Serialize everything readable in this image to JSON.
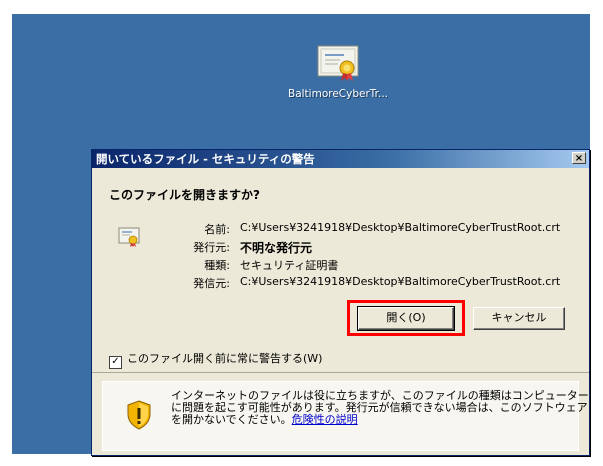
{
  "desktop": {
    "icon_label": "BaltimoreCyberTr..."
  },
  "dialog": {
    "title": "開いているファイル - セキュリティの警告",
    "close_label": "×",
    "question": "このファイルを開きますか?",
    "fields": [
      {
        "label": "名前:",
        "value": "C:¥Users¥3241918¥Desktop¥BaltimoreCyberTrustRoot.crt"
      },
      {
        "label": "発行元:",
        "value": "不明な発行元"
      },
      {
        "label": "種類:",
        "value": "セキュリティ証明書"
      },
      {
        "label": "発信元:",
        "value": "C:¥Users¥3241918¥Desktop¥BaltimoreCyberTrustRoot.crt"
      }
    ],
    "open_button": "開く(O)",
    "cancel_button": "キャンセル",
    "checkbox_label": "このファイル開く前に常に警告する(W)",
    "checkbox_mark": "✓",
    "warning_text": "インターネットのファイルは役に立ちますが、このファイルの種類はコンピューターに問題を起こす可能性があります。発行元が信頼できない場合は、このソフトウェアを開かないでください。",
    "risk_link": "危険性の説明"
  },
  "colors": {
    "desktop": "#3a6ea5",
    "highlight": "#ff0000",
    "titlebar": "#0a246a"
  }
}
